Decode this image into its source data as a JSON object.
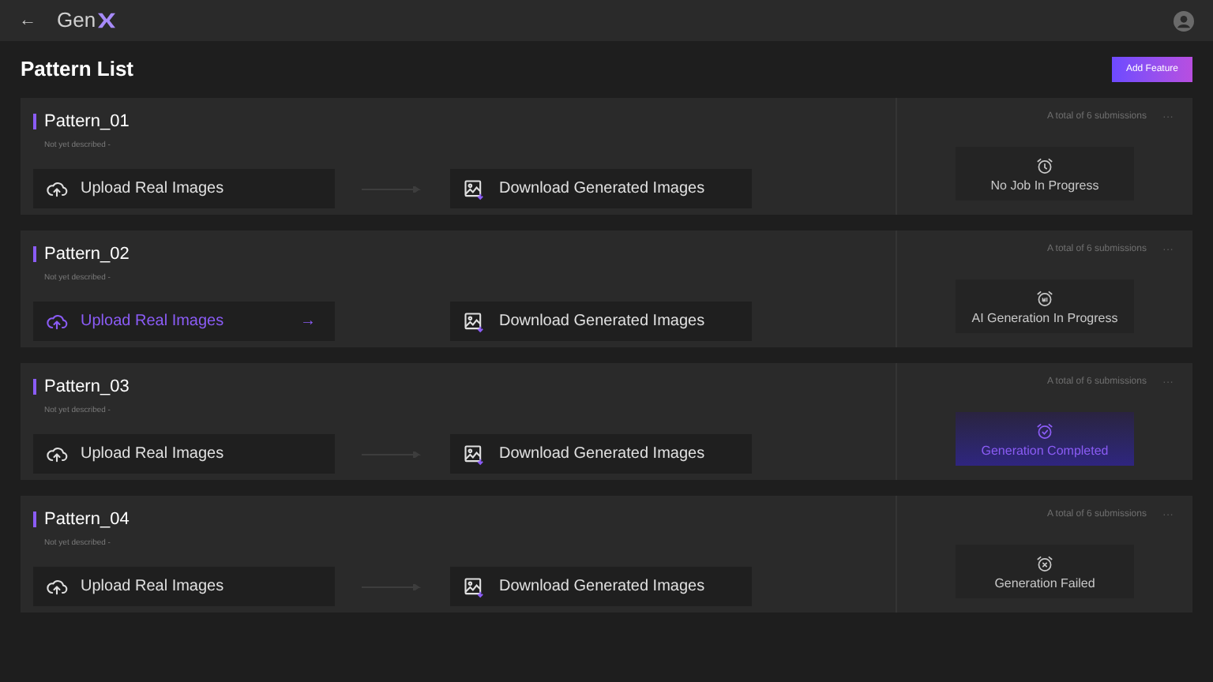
{
  "header": {
    "back": "←",
    "brand": "Gen"
  },
  "page": {
    "title": "Pattern List",
    "add_button": "Add Feature"
  },
  "patterns": [
    {
      "name": "Pattern_01",
      "description": "Not yet described -",
      "upload": {
        "label": "Upload Real Images",
        "hovered": false
      },
      "download": {
        "label": "Download Generated Images"
      },
      "submissions": "A total of 6 submissions",
      "more": "···",
      "status": {
        "kind": "none",
        "label": "No Job In Progress"
      }
    },
    {
      "name": "Pattern_02",
      "description": "Not yet described -",
      "upload": {
        "label": "Upload Real Images",
        "hovered": true,
        "arrow": "→"
      },
      "download": {
        "label": "Download Generated Images"
      },
      "submissions": "A total of 6 submissions",
      "more": "···",
      "status": {
        "kind": "ai",
        "label": "AI Generation In Progress"
      }
    },
    {
      "name": "Pattern_03",
      "description": "Not yet described -",
      "upload": {
        "label": "Upload Real Images",
        "hovered": false
      },
      "download": {
        "label": "Download Generated Images"
      },
      "submissions": "A total of 6 submissions",
      "more": "···",
      "status": {
        "kind": "completed",
        "label": "Generation Completed"
      }
    },
    {
      "name": "Pattern_04",
      "description": "Not yet described -",
      "upload": {
        "label": "Upload Real Images",
        "hovered": false
      },
      "download": {
        "label": "Download Generated Images"
      },
      "submissions": "A total of 6 submissions",
      "more": "···",
      "status": {
        "kind": "failed",
        "label": "Generation Failed"
      }
    }
  ]
}
